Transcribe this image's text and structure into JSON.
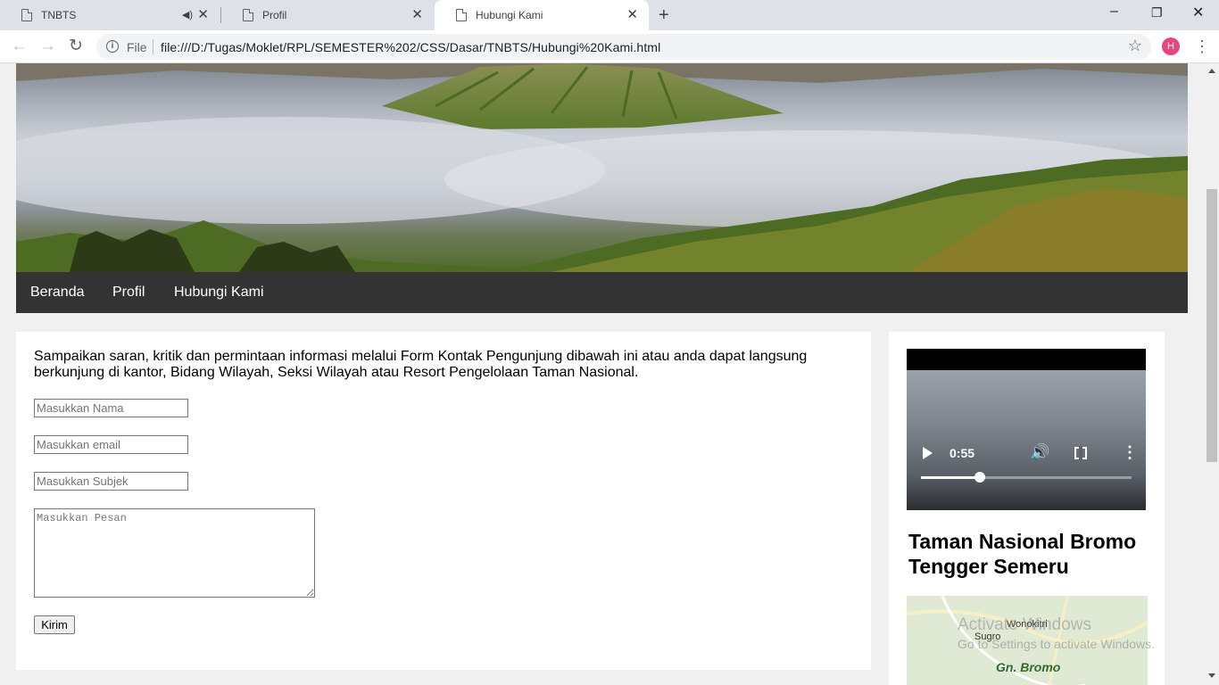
{
  "browser": {
    "tabs": [
      {
        "title": "TNBTS",
        "muted_icon": "speaker-mute-icon",
        "active": false
      },
      {
        "title": "Profil",
        "active": false
      },
      {
        "title": "Hubungi Kami",
        "active": true
      }
    ],
    "new_tab_icon": "plus-icon",
    "window_controls": {
      "minimize": "–",
      "restore": "❐",
      "close": "✕"
    },
    "address": {
      "scheme_label": "File",
      "url": "file:///D:/Tugas/Moklet/RPL/SEMESTER%202/CSS/Dasar/TNBTS/Hubungi%20Kami.html"
    },
    "profile_initial": "H",
    "profile_color": "#e8457e"
  },
  "nav": {
    "items": [
      "Beranda",
      "Profil",
      "Hubungi Kami"
    ]
  },
  "contact": {
    "intro": "Sampaikan saran, kritik dan permintaan informasi melalui Form Kontak Pengunjung dibawah ini atau anda dapat langsung berkunjung di kantor, Bidang Wilayah, Seksi Wilayah atau Resort Pengelolaan Taman Nasional.",
    "name_placeholder": "Masukkan Nama",
    "email_placeholder": "Masukkan email",
    "subject_placeholder": "Masukkan Subjek",
    "message_placeholder": "Masukkan Pesan",
    "submit_label": "Kirim"
  },
  "sidebar": {
    "video": {
      "time": "0:55",
      "progress_fraction": 0.28
    },
    "title": "Taman Nasional Bromo Tengger Semeru",
    "map_labels": {
      "village1": "Wonokitri",
      "village2": "Sugro",
      "peak": "Gn. Bromo"
    }
  },
  "watermark": {
    "line1": "Activate Windows",
    "line2": "Go to Settings to activate Windows."
  },
  "colors": {
    "navbar": "#333333",
    "page_bg": "#f0f0f0",
    "accent_profile": "#e8457e"
  }
}
